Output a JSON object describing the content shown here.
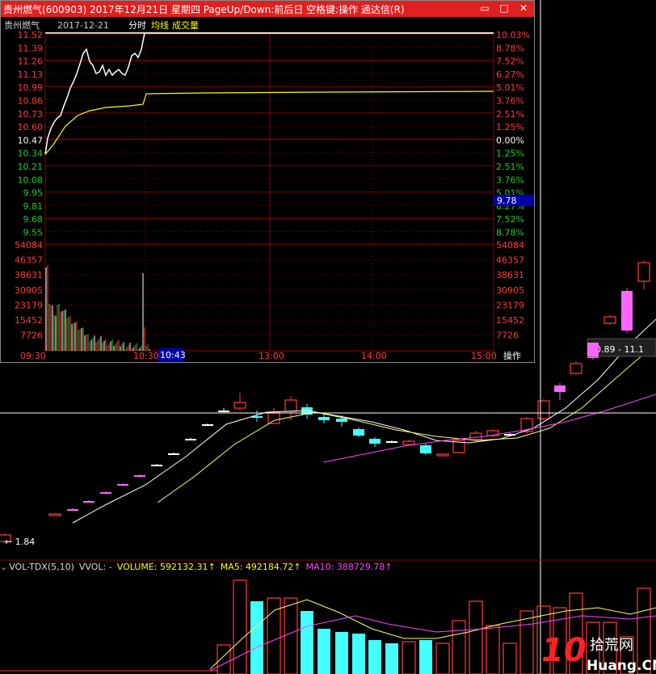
{
  "popup": {
    "title": "贵州燃气(600903) 2017年12月21日 星期四 PageUp/Down:前后日 空格键:操作 通达信(R)",
    "buttons": [
      "▭",
      "□",
      "✕"
    ],
    "legend": {
      "name": "贵州燃气",
      "date": "2017-12-21",
      "mode": "分时",
      "avg": "均线",
      "vol": "成交量"
    },
    "price_labels": [
      "11.52",
      "11.39",
      "11.26",
      "11.13",
      "10.99",
      "10.86",
      "10.73",
      "10.60",
      "10.47",
      "10.34",
      "10.21",
      "10.08",
      "9.95",
      "9.81",
      "9.68",
      "9.55"
    ],
    "pct_labels": [
      "10.03%",
      "8.78%",
      "7.52%",
      "6.27%",
      "5.01%",
      "3.76%",
      "2.51%",
      "1.25%",
      "0.00%",
      "1.25%",
      "2.51%",
      "3.76%",
      "5.01%",
      "6.27%",
      "7.52%",
      "8.78%"
    ],
    "current_price": "9.78",
    "vol_labels": [
      "54084",
      "46357",
      "38631",
      "30905",
      "23179",
      "15452",
      "7726"
    ],
    "time_labels": [
      "09:30",
      "10:30",
      "13:00",
      "14:00",
      "15:00"
    ],
    "cursor_time": "10:43",
    "operate_label": "操作",
    "colors": {
      "up": "#ff3c3c",
      "down": "#22cc22",
      "neutral": "#ffffff",
      "avg": "#ffff00",
      "grid": "#8b0000"
    }
  },
  "main": {
    "low_label": "← 1.84",
    "tooltip": "10.89 - 11.1"
  },
  "volume_header": {
    "indicator": "VOL-TDX(5,10)",
    "vvol": "VVOL: -",
    "volume": "VOLUME: 592132.31↑",
    "ma5": "MA5: 492184.72↑",
    "ma10": "MA10: 388729.78↑"
  },
  "watermark": {
    "num": "10",
    "cn": "拾荒网",
    "url": "Huang.CN"
  }
}
